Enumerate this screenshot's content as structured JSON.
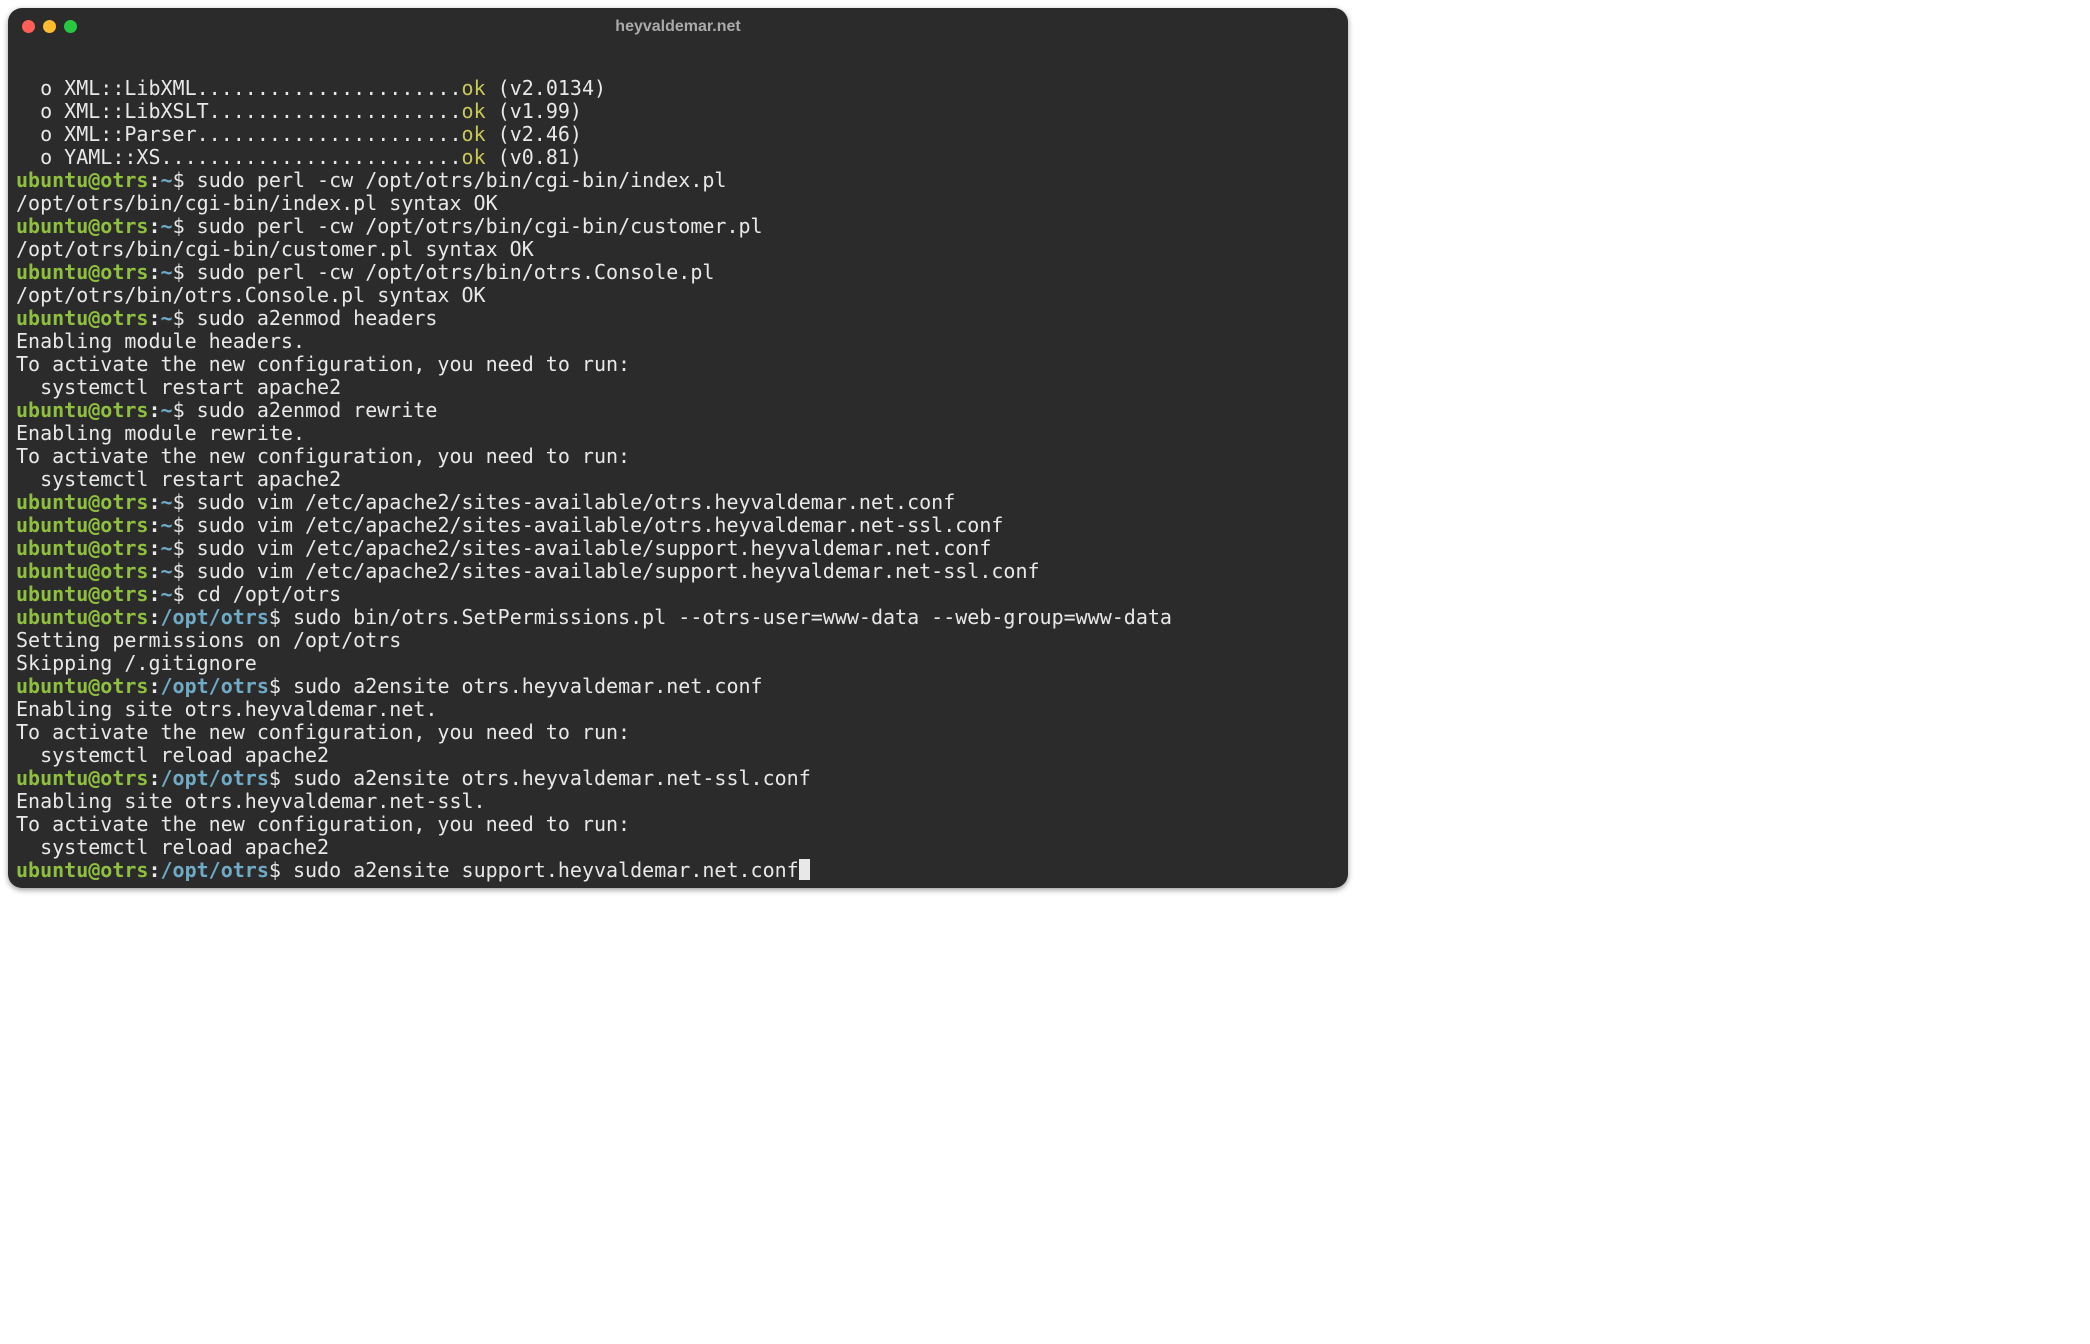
{
  "window": {
    "title": "heyvaldemar.net"
  },
  "prompt": {
    "user": "ubuntu",
    "at": "@",
    "host": "otrs",
    "home_path": "~",
    "otrs_path": "/opt/otrs",
    "dollar": "$"
  },
  "lines": {
    "mod1": "  o XML::LibXML......................",
    "mod1ok": "ok",
    "mod1v": " (v2.0134)",
    "mod2": "  o XML::LibXSLT.....................",
    "mod2ok": "ok",
    "mod2v": " (v1.99)",
    "mod3": "  o XML::Parser......................",
    "mod3ok": "ok",
    "mod3v": " (v2.46)",
    "mod4": "  o YAML::XS.........................",
    "mod4ok": "ok",
    "mod4v": " (v0.81)",
    "cmd1": " sudo perl -cw /opt/otrs/bin/cgi-bin/index.pl",
    "out1": "/opt/otrs/bin/cgi-bin/index.pl syntax OK",
    "cmd2": " sudo perl -cw /opt/otrs/bin/cgi-bin/customer.pl",
    "out2": "/opt/otrs/bin/cgi-bin/customer.pl syntax OK",
    "cmd3": " sudo perl -cw /opt/otrs/bin/otrs.Console.pl",
    "out3": "/opt/otrs/bin/otrs.Console.pl syntax OK",
    "cmd4": " sudo a2enmod headers",
    "out4a": "Enabling module headers.",
    "out4b": "To activate the new configuration, you need to run:",
    "out4c": "  systemctl restart apache2",
    "cmd5": " sudo a2enmod rewrite",
    "out5a": "Enabling module rewrite.",
    "out5b": "To activate the new configuration, you need to run:",
    "out5c": "  systemctl restart apache2",
    "cmd6": " sudo vim /etc/apache2/sites-available/otrs.heyvaldemar.net.conf",
    "cmd7": " sudo vim /etc/apache2/sites-available/otrs.heyvaldemar.net-ssl.conf",
    "cmd8": " sudo vim /etc/apache2/sites-available/support.heyvaldemar.net.conf",
    "cmd9": " sudo vim /etc/apache2/sites-available/support.heyvaldemar.net-ssl.conf",
    "cmd10": " cd /opt/otrs",
    "cmd11": " sudo bin/otrs.SetPermissions.pl --otrs-user=www-data --web-group=www-data",
    "out11a": "Setting permissions on /opt/otrs",
    "out11b": "Skipping /.gitignore",
    "cmd12": " sudo a2ensite otrs.heyvaldemar.net.conf",
    "out12a": "Enabling site otrs.heyvaldemar.net.",
    "out12b": "To activate the new configuration, you need to run:",
    "out12c": "  systemctl reload apache2",
    "cmd13": " sudo a2ensite otrs.heyvaldemar.net-ssl.conf",
    "out13a": "Enabling site otrs.heyvaldemar.net-ssl.",
    "out13b": "To activate the new configuration, you need to run:",
    "out13c": "  systemctl reload apache2",
    "cmd14": " sudo a2ensite support.heyvaldemar.net.conf"
  }
}
